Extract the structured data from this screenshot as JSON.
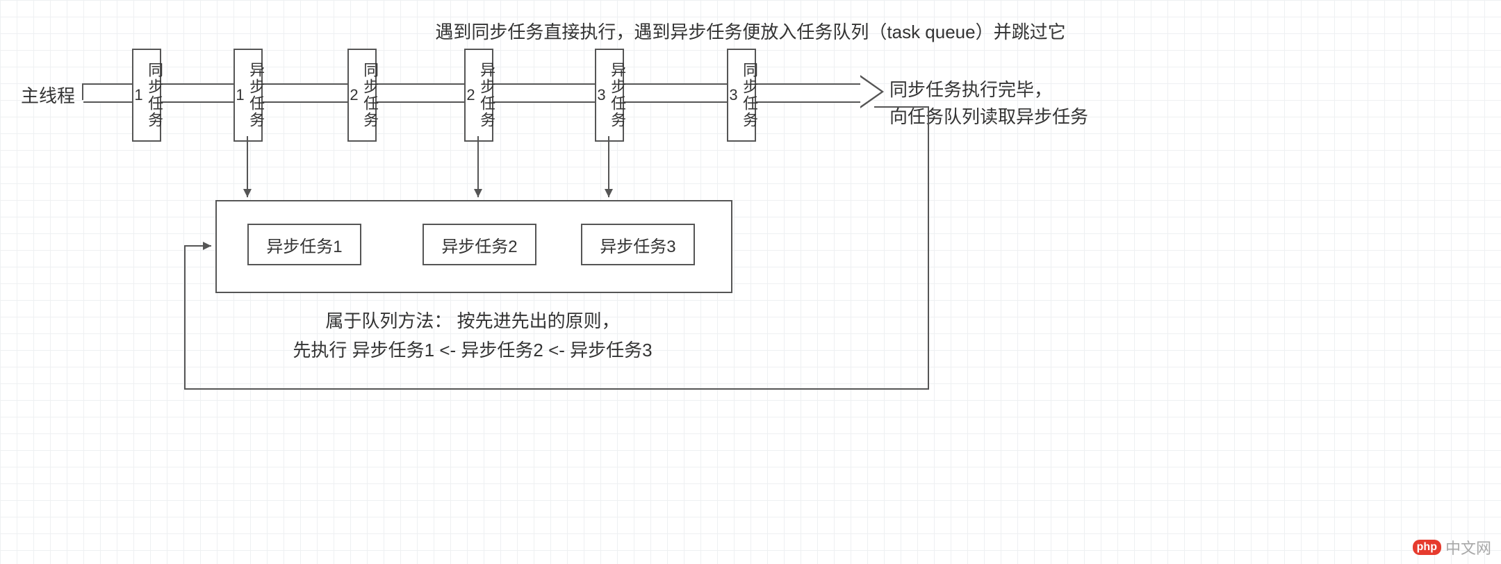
{
  "top_caption": "遇到同步任务直接执行，遇到异步任务便放入任务队列（task queue）并跳过它",
  "main_thread_label": "主线程",
  "end_label_line1": "同步任务执行完毕，",
  "end_label_line2": "向任务队列读取异步任务",
  "tasks": {
    "sync1": "同步任务1",
    "async1": "异步任务1",
    "sync2": "同步任务2",
    "async2": "异步任务2",
    "async3": "异步任务3",
    "sync3": "同步任务3"
  },
  "queue_items": {
    "q1": "异步任务1",
    "q2": "异步任务2",
    "q3": "异步任务3"
  },
  "queue_caption_line1": "属于队列方法：  按先进先出的原则，",
  "queue_caption_line2": "先执行  异步任务1 <-  异步任务2 <-  异步任务3",
  "watermark": {
    "badge": "php",
    "text": "中文网"
  }
}
